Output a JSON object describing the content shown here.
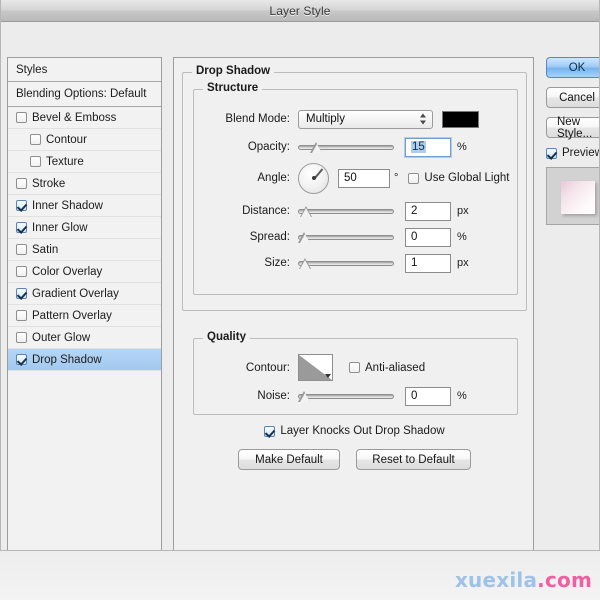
{
  "window": {
    "title": "Layer Style"
  },
  "styles_panel": {
    "header": "Styles",
    "blending_options": "Blending Options: Default",
    "effects": [
      {
        "label": "Bevel & Emboss",
        "checked": false,
        "indent": false,
        "selected": false
      },
      {
        "label": "Contour",
        "checked": false,
        "indent": true,
        "selected": false
      },
      {
        "label": "Texture",
        "checked": false,
        "indent": true,
        "selected": false
      },
      {
        "label": "Stroke",
        "checked": false,
        "indent": false,
        "selected": false
      },
      {
        "label": "Inner Shadow",
        "checked": true,
        "indent": false,
        "selected": false
      },
      {
        "label": "Inner Glow",
        "checked": true,
        "indent": false,
        "selected": false
      },
      {
        "label": "Satin",
        "checked": false,
        "indent": false,
        "selected": false
      },
      {
        "label": "Color Overlay",
        "checked": false,
        "indent": false,
        "selected": false
      },
      {
        "label": "Gradient Overlay",
        "checked": true,
        "indent": false,
        "selected": false
      },
      {
        "label": "Pattern Overlay",
        "checked": false,
        "indent": false,
        "selected": false
      },
      {
        "label": "Outer Glow",
        "checked": false,
        "indent": false,
        "selected": false
      },
      {
        "label": "Drop Shadow",
        "checked": true,
        "indent": false,
        "selected": true
      }
    ]
  },
  "main": {
    "group_title": "Drop Shadow",
    "structure": {
      "legend": "Structure",
      "blend_mode_label": "Blend Mode:",
      "blend_mode_value": "Multiply",
      "shadow_color": "#000000",
      "opacity_label": "Opacity:",
      "opacity_value": "15",
      "opacity_unit": "%",
      "opacity_percent": 15,
      "angle_label": "Angle:",
      "angle_value": "50",
      "angle_unit": "°",
      "use_global_light_label": "Use Global Light",
      "use_global_light_checked": false,
      "distance_label": "Distance:",
      "distance_value": "2",
      "distance_unit": "px",
      "distance_percent": 2,
      "spread_label": "Spread:",
      "spread_value": "0",
      "spread_unit": "%",
      "spread_percent": 0,
      "size_label": "Size:",
      "size_value": "1",
      "size_unit": "px",
      "size_percent": 1
    },
    "quality": {
      "legend": "Quality",
      "contour_label": "Contour:",
      "anti_aliased_label": "Anti-aliased",
      "anti_aliased_checked": false,
      "noise_label": "Noise:",
      "noise_value": "0",
      "noise_unit": "%",
      "noise_percent": 0
    },
    "knockout_label": "Layer Knocks Out Drop Shadow",
    "knockout_checked": true,
    "make_default_label": "Make Default",
    "reset_default_label": "Reset to Default"
  },
  "buttons": {
    "ok": "OK",
    "cancel": "Cancel",
    "new_style": "New Style...",
    "preview_label": "Preview",
    "preview_checked": true
  },
  "watermark": {
    "name": "xuexila",
    "tld": ".com"
  }
}
